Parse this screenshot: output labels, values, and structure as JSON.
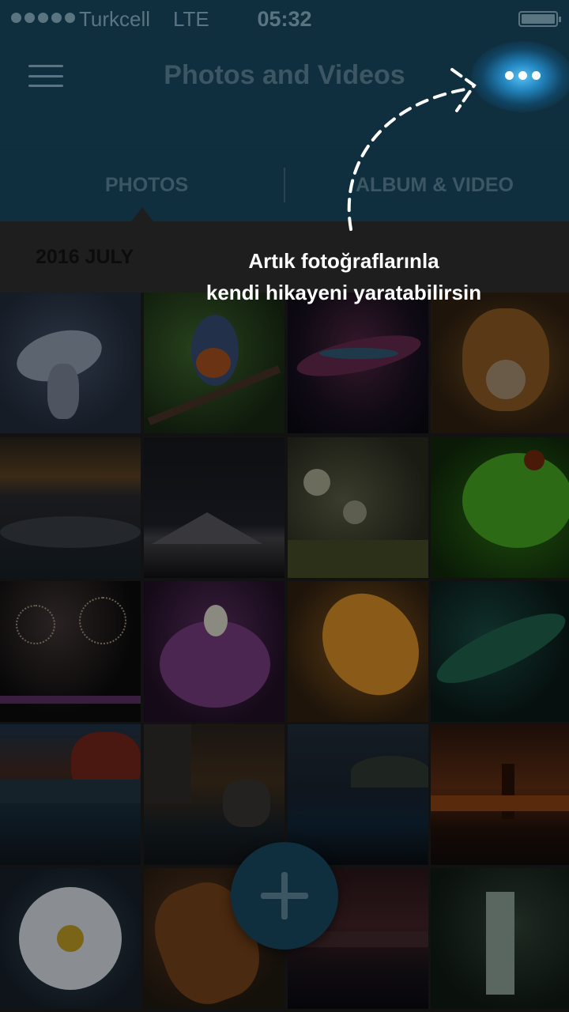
{
  "status": {
    "carrier": "Turkcell",
    "network": "LTE",
    "time": "05:32"
  },
  "header": {
    "title": "Photos and Videos",
    "menu_icon": "hamburger-menu-icon",
    "more_icon": "more-dots-icon"
  },
  "tabs": [
    {
      "label": "PHOTOS",
      "active": true
    },
    {
      "label": "ALBUM & VIDEO",
      "active": false
    }
  ],
  "section": {
    "date": "2016 JULY"
  },
  "photos": [
    "snowy owl",
    "bluebird on branch",
    "nebula",
    "tiger",
    "sunset over sea",
    "mountain ridge at night",
    "white flowers",
    "green gecko",
    "fireworks over lake",
    "purple orchid",
    "autumn leaves",
    "aurora",
    "autumn lake",
    "sea stacks at sunset",
    "coastline at dusk",
    "lighthouse at sunset",
    "daisy",
    "tropical plant",
    "dusk beach",
    "waterfall"
  ],
  "fab": {
    "icon": "plus-icon"
  },
  "coach_mark": {
    "line1": "Artık fotoğraflarınla",
    "line2": "kendi hikayeni yaratabilirsin"
  },
  "colors": {
    "header_bg": "#0f2f3f",
    "highlight_glow": "#3ab4f0",
    "overlay_text": "#ffffff"
  }
}
